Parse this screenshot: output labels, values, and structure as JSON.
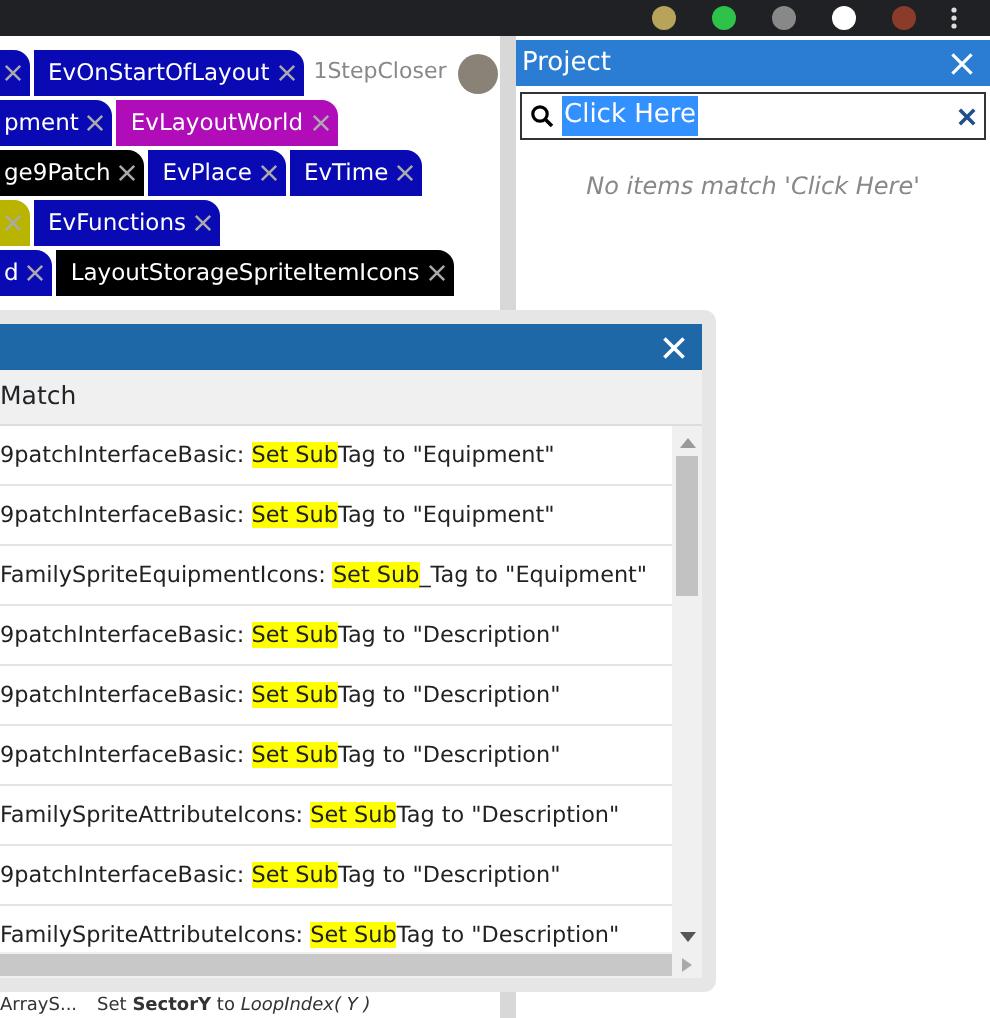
{
  "tab_rows": [
    [
      {
        "color": "#0a0ab4"
      },
      {
        "label": "EvOnStartOfLayout",
        "color": "#0a0ab4"
      }
    ],
    [
      {
        "label": "pment",
        "color": "#0a0ab4"
      },
      {
        "label": "EvLayoutWorld",
        "color": "#b00cb8"
      }
    ],
    [
      {
        "label": "ge9Patch",
        "color": "#000000"
      },
      {
        "label": "EvPlace",
        "color": "#0a0ab4"
      },
      {
        "label": "EvTime",
        "color": "#0a0ab4"
      }
    ],
    [
      {
        "color": "#b8b400"
      },
      {
        "label": "EvFunctions",
        "color": "#0a0ab4"
      }
    ],
    [
      {
        "label": "d",
        "color": "#0a0ab4"
      },
      {
        "label": "LayoutStorageSpriteItemIcons",
        "color": "#000000"
      }
    ]
  ],
  "user": {
    "name": "1StepCloser"
  },
  "project": {
    "title": "Project",
    "search": {
      "value": "Click Here",
      "selected": true
    },
    "empty_message": "No items match 'Click Here'"
  },
  "dialog": {
    "column": "Match",
    "rows": [
      {
        "object": "9patchInterfaceBasic: ",
        "match": "Set Sub",
        "rest": "Tag to \"Equipment\""
      },
      {
        "object": "9patchInterfaceBasic: ",
        "match": "Set Sub",
        "rest": "Tag to \"Equipment\""
      },
      {
        "object": "FamilySpriteEquipmentIcons: ",
        "match": "Set Sub",
        "rest": "_Tag to \"Equipment\""
      },
      {
        "object": "9patchInterfaceBasic: ",
        "match": "Set Sub",
        "rest": "Tag to \"Description\""
      },
      {
        "object": "9patchInterfaceBasic: ",
        "match": "Set Sub",
        "rest": "Tag to \"Description\""
      },
      {
        "object": "9patchInterfaceBasic: ",
        "match": "Set Sub",
        "rest": "Tag to \"Description\""
      },
      {
        "object": "FamilySpriteAttributeIcons: ",
        "match": "Set Sub",
        "rest": "Tag to \"Description\""
      },
      {
        "object": "9patchInterfaceBasic: ",
        "match": "Set Sub",
        "rest": "Tag to \"Description\""
      },
      {
        "object": "FamilySpriteAttributeIcons: ",
        "match": "Set Sub",
        "rest": "Tag to \"Description\""
      }
    ]
  },
  "bottom_strip": [
    "ArrayS...",
    "Set **SectorY** to *LoopIndex( Y )*"
  ]
}
